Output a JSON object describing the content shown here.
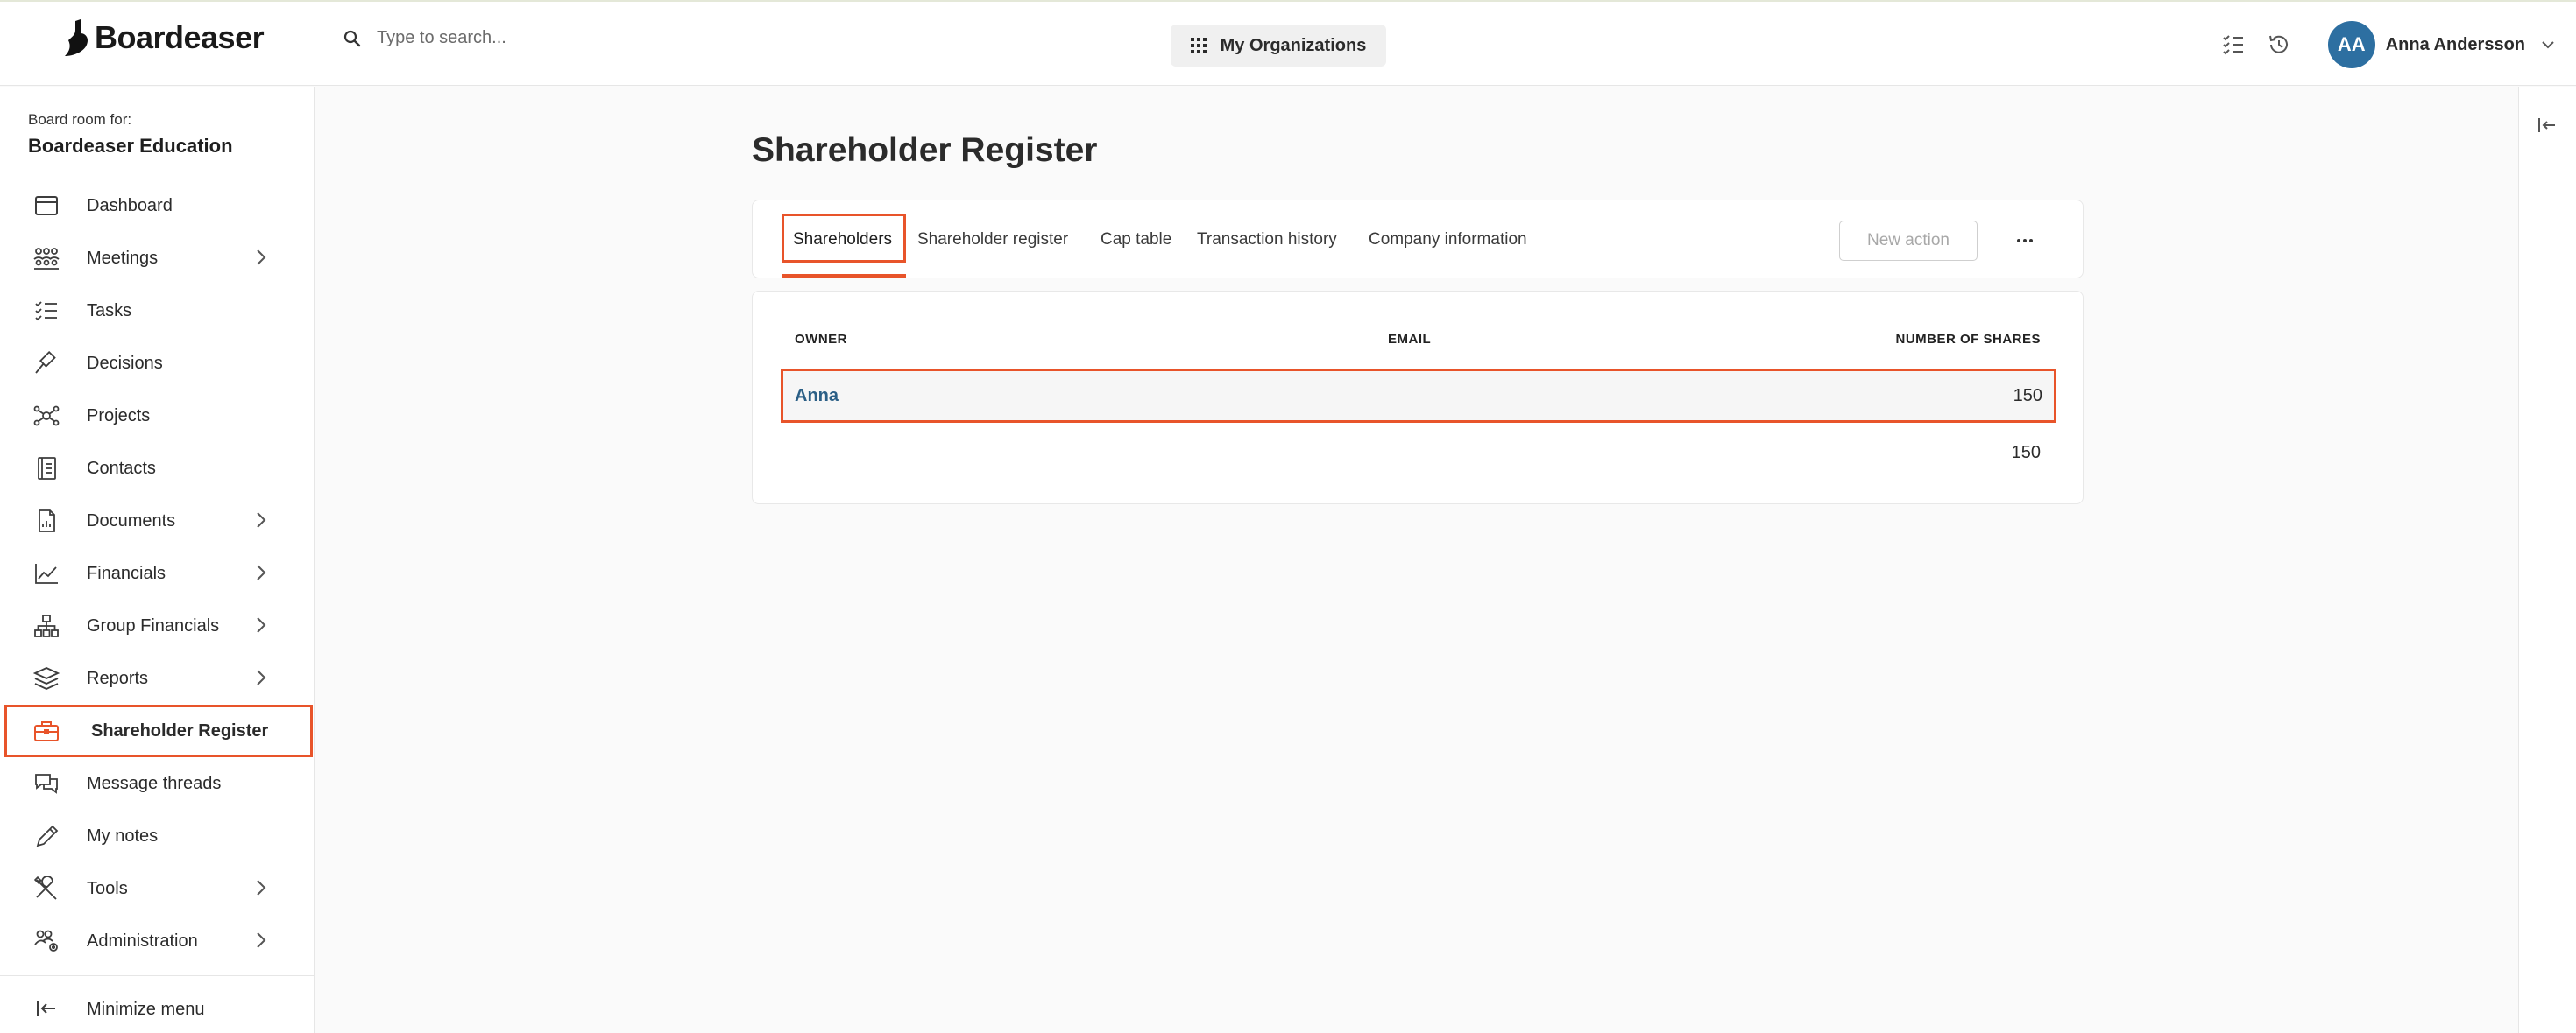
{
  "app": {
    "brand": "Boardeaser"
  },
  "search": {
    "placeholder": "Type to search..."
  },
  "header": {
    "orgs_label": "My Organizations",
    "user_initials": "AA",
    "user_name": "Anna Andersson"
  },
  "sidebar": {
    "boardroom_label": "Board room for:",
    "boardroom_name": "Boardeaser Education",
    "items": [
      {
        "label": "Dashboard",
        "icon": "calendar-icon",
        "chevron": false
      },
      {
        "label": "Meetings",
        "icon": "meeting-icon",
        "chevron": true
      },
      {
        "label": "Tasks",
        "icon": "task-list-icon",
        "chevron": false
      },
      {
        "label": "Decisions",
        "icon": "gavel-icon",
        "chevron": false
      },
      {
        "label": "Projects",
        "icon": "network-icon",
        "chevron": false
      },
      {
        "label": "Contacts",
        "icon": "address-book-icon",
        "chevron": false
      },
      {
        "label": "Documents",
        "icon": "document-icon",
        "chevron": true
      },
      {
        "label": "Financials",
        "icon": "line-chart-icon",
        "chevron": true
      },
      {
        "label": "Group Financials",
        "icon": "org-chart-icon",
        "chevron": true
      },
      {
        "label": "Reports",
        "icon": "layers-icon",
        "chevron": true
      },
      {
        "label": "Shareholder Register",
        "icon": "briefcase-icon",
        "chevron": false,
        "active": true
      },
      {
        "label": "Message threads",
        "icon": "chat-icon",
        "chevron": false
      },
      {
        "label": "My notes",
        "icon": "pencil-icon",
        "chevron": false
      },
      {
        "label": "Tools",
        "icon": "tools-icon",
        "chevron": true
      },
      {
        "label": "Administration",
        "icon": "admin-users-icon",
        "chevron": true
      }
    ],
    "minimize_label": "Minimize menu"
  },
  "main": {
    "title": "Shareholder Register",
    "tabs": [
      "Shareholders",
      "Shareholder register",
      "Cap table",
      "Transaction history",
      "Company information"
    ],
    "active_tab": 0,
    "new_action_label": "New action",
    "more_label": "···",
    "table": {
      "headers": {
        "owner": "OWNER",
        "email": "EMAIL",
        "shares": "NUMBER OF SHARES"
      },
      "rows": [
        {
          "owner": "Anna",
          "email": "",
          "shares": "150"
        }
      ],
      "total_shares": "150"
    }
  },
  "colors": {
    "accent": "#e8542a",
    "avatar": "#2d6fa1",
    "link": "#2b5f86"
  }
}
